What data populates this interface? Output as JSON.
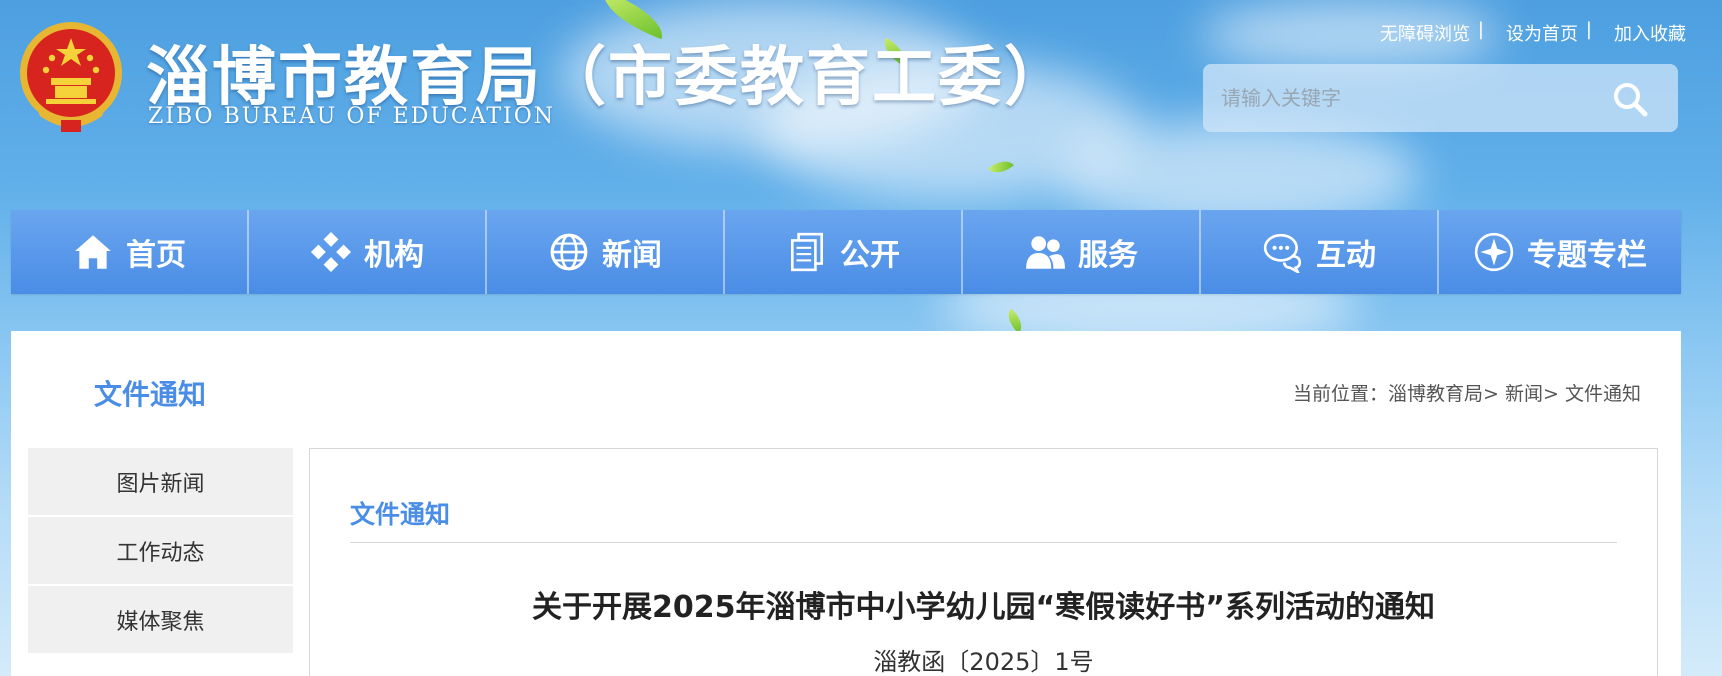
{
  "header": {
    "title": "淄博市教育局（市委教育工委）",
    "subtitle": "ZIBO BUREAU OF EDUCATION",
    "top_links": [
      "无障碍浏览",
      "设为首页",
      "加入收藏"
    ],
    "search": {
      "placeholder": "请输入关键字",
      "icon": "search-icon"
    }
  },
  "nav": {
    "items": [
      {
        "label": "首页",
        "icon": "home-icon"
      },
      {
        "label": "机构",
        "icon": "diamond-grid-icon"
      },
      {
        "label": "新闻",
        "icon": "globe-icon"
      },
      {
        "label": "公开",
        "icon": "documents-icon"
      },
      {
        "label": "服务",
        "icon": "users-icon"
      },
      {
        "label": "互动",
        "icon": "chat-bubbles-icon"
      },
      {
        "label": "专题专栏",
        "icon": "compass-icon"
      }
    ]
  },
  "main": {
    "section_title": "文件通知",
    "breadcrumb": {
      "prefix": "当前位置：",
      "items": [
        "淄博教育局",
        "新闻",
        "文件通知"
      ],
      "separator": ">"
    },
    "sidebar": [
      "图片新闻",
      "工作动态",
      "媒体聚焦"
    ],
    "panel_title": "文件通知",
    "doc_title": "关于开展2025年淄博市中小学幼儿园“寒假读好书”系列活动的通知",
    "doc_number": "淄教函〔2025〕1号"
  },
  "colors": {
    "accent": "#4a8de6",
    "nav_bg": "#5a98ea"
  }
}
